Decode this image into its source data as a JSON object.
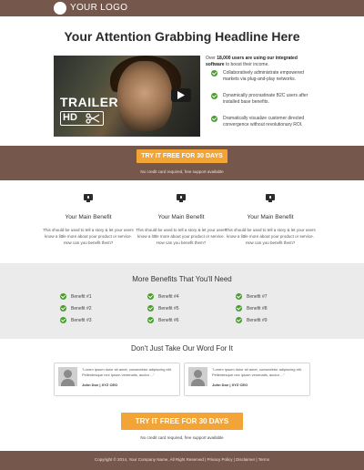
{
  "header": {
    "logo_text": "YOUR LOGO"
  },
  "hero": {
    "headline": "Your Attention Grabbing Headline Here",
    "video": {
      "trailer_label": "TRAILER",
      "hd_label": "HD"
    },
    "intro_prefix": "Over ",
    "intro_bold": "18,000 users are using our integrated software",
    "intro_suffix": " to boost their income.",
    "checks": [
      "Collaboratively administrate empowered markets via plug-and-play networks.",
      "Dynamically procrastinate B2C users after installed base benefits.",
      "Dramatically visualize customer directed convergence without revolutionary ROI."
    ]
  },
  "cta_top": {
    "button": "TRY IT FREE FOR 30 DAYS",
    "note": "No credit card required, free support available"
  },
  "benefits": [
    {
      "title": "Your Main Benefit",
      "text": "This should be used to tell a story & let your users know a little more about your product or service. How can you benefit them?"
    },
    {
      "title": "Your Main Benefit",
      "text": "This should be used to tell a story & let your users know a little more about your product or service. How can you benefit them?"
    },
    {
      "title": "Your Main Benefit",
      "text": "This should be used to tell a story & let your users know a little more about your product or service. How can you benefit them?"
    }
  ],
  "more_benefits": {
    "title": "More Benefits That You'll Need",
    "items": [
      "Benefit #1",
      "Benefit #4",
      "Benefit #7",
      "Benefit #2",
      "Benefit #5",
      "Benefit #8",
      "Benefit #3",
      "Benefit #6",
      "Benefit #9"
    ]
  },
  "testimonials": {
    "title": "Don't Just Take Our Word For It",
    "items": [
      {
        "quote": "\"Lorem ipsum dolor sit amet, consectetur adipiscing elit. Pellentesque nec ipsum venenatis, auctor ...\"",
        "author": "John Doe | XYZ CEO"
      },
      {
        "quote": "\"Lorem ipsum dolor sit amet, consectetur adipiscing elit. Pellentesque nec ipsum venenatis, auctor ...\"",
        "author": "John Doe | XYZ CEO"
      }
    ]
  },
  "cta_bottom": {
    "button": "TRY IT FREE FOR 30 DAYS",
    "note": "No credit card required, free support available"
  },
  "footer": {
    "text": "Copyright © 2014, Your Company Name, All Right Reserved | Privacy Policy | Disclaimer | Terms"
  },
  "colors": {
    "brand_brown": "#76574b",
    "cta_orange": "#f2a536",
    "check_green": "#4a9e2f",
    "panel_gray": "#ebebeb"
  },
  "icons": [
    "logo-circle-icon",
    "play-icon",
    "scissors-icon",
    "check-icon",
    "monitor-icon",
    "avatar-icon"
  ]
}
